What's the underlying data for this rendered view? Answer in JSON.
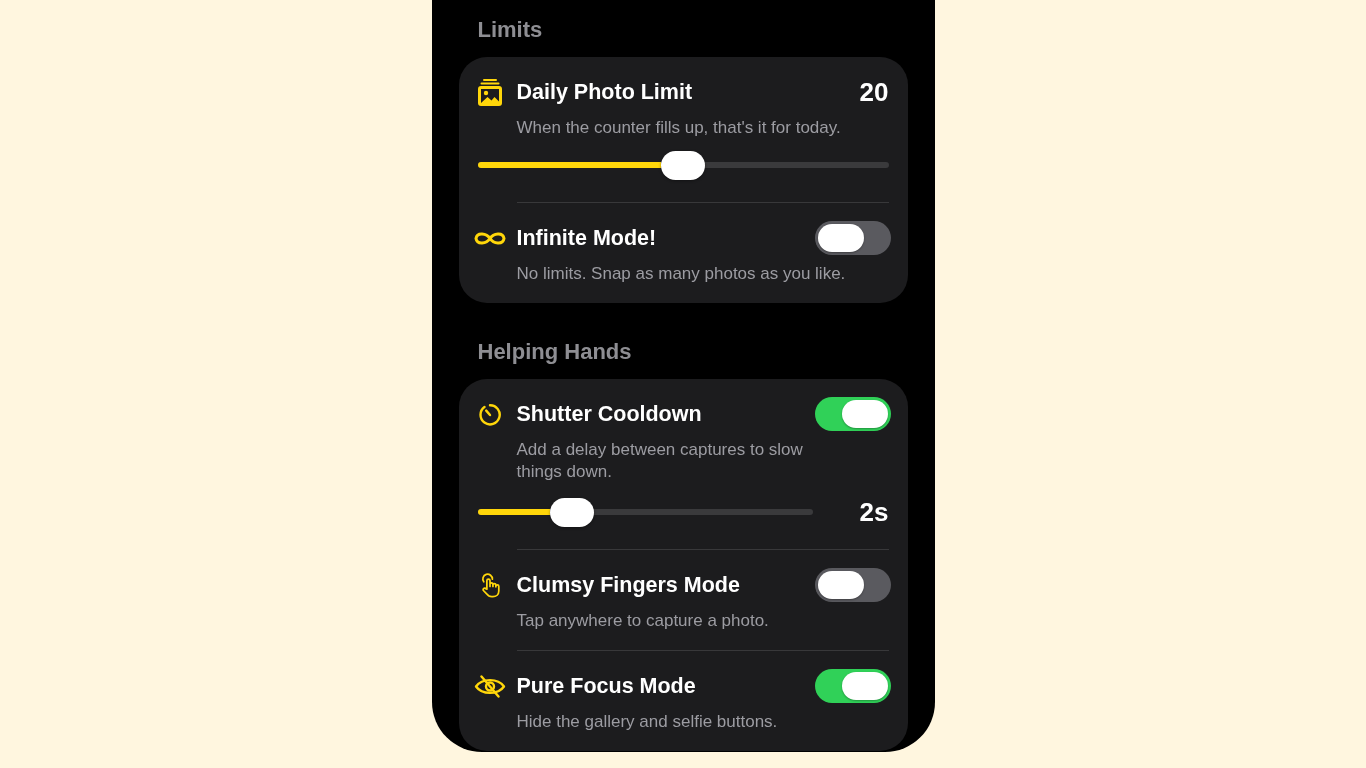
{
  "sections": [
    {
      "title": "Limits",
      "rows": [
        {
          "kind": "slider",
          "title": "Daily Photo Limit",
          "value": "20",
          "description": "When the counter fills up, that's it for today.",
          "level": 0.5
        },
        {
          "kind": "toggle",
          "title": "Infinite Mode!",
          "on": false,
          "description": "No limits. Snap as many photos as you like."
        }
      ]
    },
    {
      "title": "Helping Hands",
      "rows": [
        {
          "kind": "combo",
          "title": "Shutter Cooldown",
          "on": true,
          "description": "Add a delay between captures to slow things down.",
          "level": 0.25,
          "value": "2s"
        },
        {
          "kind": "toggle",
          "title": "Clumsy Fingers Mode",
          "on": false,
          "description": "Tap anywhere to capture a photo."
        },
        {
          "kind": "toggle",
          "title": "Pure Focus Mode",
          "on": true,
          "description": "Hide the gallery and selfie buttons."
        }
      ]
    }
  ]
}
